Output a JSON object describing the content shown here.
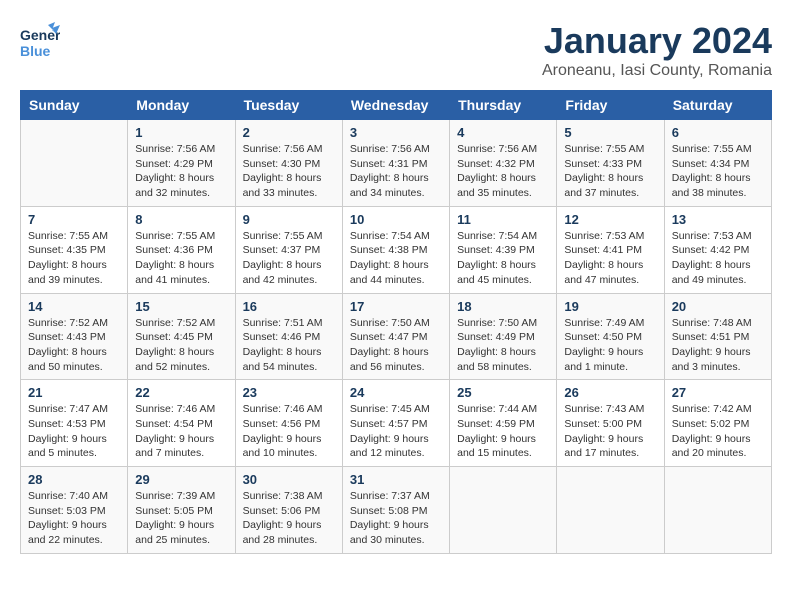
{
  "header": {
    "logo_general": "General",
    "logo_blue": "Blue",
    "month_title": "January 2024",
    "location": "Aroneanu, Iasi County, Romania"
  },
  "weekdays": [
    "Sunday",
    "Monday",
    "Tuesday",
    "Wednesday",
    "Thursday",
    "Friday",
    "Saturday"
  ],
  "weeks": [
    [
      {
        "day": "",
        "sunrise": "",
        "sunset": "",
        "daylight": ""
      },
      {
        "day": "1",
        "sunrise": "Sunrise: 7:56 AM",
        "sunset": "Sunset: 4:29 PM",
        "daylight": "Daylight: 8 hours and 32 minutes."
      },
      {
        "day": "2",
        "sunrise": "Sunrise: 7:56 AM",
        "sunset": "Sunset: 4:30 PM",
        "daylight": "Daylight: 8 hours and 33 minutes."
      },
      {
        "day": "3",
        "sunrise": "Sunrise: 7:56 AM",
        "sunset": "Sunset: 4:31 PM",
        "daylight": "Daylight: 8 hours and 34 minutes."
      },
      {
        "day": "4",
        "sunrise": "Sunrise: 7:56 AM",
        "sunset": "Sunset: 4:32 PM",
        "daylight": "Daylight: 8 hours and 35 minutes."
      },
      {
        "day": "5",
        "sunrise": "Sunrise: 7:55 AM",
        "sunset": "Sunset: 4:33 PM",
        "daylight": "Daylight: 8 hours and 37 minutes."
      },
      {
        "day": "6",
        "sunrise": "Sunrise: 7:55 AM",
        "sunset": "Sunset: 4:34 PM",
        "daylight": "Daylight: 8 hours and 38 minutes."
      }
    ],
    [
      {
        "day": "7",
        "sunrise": "Sunrise: 7:55 AM",
        "sunset": "Sunset: 4:35 PM",
        "daylight": "Daylight: 8 hours and 39 minutes."
      },
      {
        "day": "8",
        "sunrise": "Sunrise: 7:55 AM",
        "sunset": "Sunset: 4:36 PM",
        "daylight": "Daylight: 8 hours and 41 minutes."
      },
      {
        "day": "9",
        "sunrise": "Sunrise: 7:55 AM",
        "sunset": "Sunset: 4:37 PM",
        "daylight": "Daylight: 8 hours and 42 minutes."
      },
      {
        "day": "10",
        "sunrise": "Sunrise: 7:54 AM",
        "sunset": "Sunset: 4:38 PM",
        "daylight": "Daylight: 8 hours and 44 minutes."
      },
      {
        "day": "11",
        "sunrise": "Sunrise: 7:54 AM",
        "sunset": "Sunset: 4:39 PM",
        "daylight": "Daylight: 8 hours and 45 minutes."
      },
      {
        "day": "12",
        "sunrise": "Sunrise: 7:53 AM",
        "sunset": "Sunset: 4:41 PM",
        "daylight": "Daylight: 8 hours and 47 minutes."
      },
      {
        "day": "13",
        "sunrise": "Sunrise: 7:53 AM",
        "sunset": "Sunset: 4:42 PM",
        "daylight": "Daylight: 8 hours and 49 minutes."
      }
    ],
    [
      {
        "day": "14",
        "sunrise": "Sunrise: 7:52 AM",
        "sunset": "Sunset: 4:43 PM",
        "daylight": "Daylight: 8 hours and 50 minutes."
      },
      {
        "day": "15",
        "sunrise": "Sunrise: 7:52 AM",
        "sunset": "Sunset: 4:45 PM",
        "daylight": "Daylight: 8 hours and 52 minutes."
      },
      {
        "day": "16",
        "sunrise": "Sunrise: 7:51 AM",
        "sunset": "Sunset: 4:46 PM",
        "daylight": "Daylight: 8 hours and 54 minutes."
      },
      {
        "day": "17",
        "sunrise": "Sunrise: 7:50 AM",
        "sunset": "Sunset: 4:47 PM",
        "daylight": "Daylight: 8 hours and 56 minutes."
      },
      {
        "day": "18",
        "sunrise": "Sunrise: 7:50 AM",
        "sunset": "Sunset: 4:49 PM",
        "daylight": "Daylight: 8 hours and 58 minutes."
      },
      {
        "day": "19",
        "sunrise": "Sunrise: 7:49 AM",
        "sunset": "Sunset: 4:50 PM",
        "daylight": "Daylight: 9 hours and 1 minute."
      },
      {
        "day": "20",
        "sunrise": "Sunrise: 7:48 AM",
        "sunset": "Sunset: 4:51 PM",
        "daylight": "Daylight: 9 hours and 3 minutes."
      }
    ],
    [
      {
        "day": "21",
        "sunrise": "Sunrise: 7:47 AM",
        "sunset": "Sunset: 4:53 PM",
        "daylight": "Daylight: 9 hours and 5 minutes."
      },
      {
        "day": "22",
        "sunrise": "Sunrise: 7:46 AM",
        "sunset": "Sunset: 4:54 PM",
        "daylight": "Daylight: 9 hours and 7 minutes."
      },
      {
        "day": "23",
        "sunrise": "Sunrise: 7:46 AM",
        "sunset": "Sunset: 4:56 PM",
        "daylight": "Daylight: 9 hours and 10 minutes."
      },
      {
        "day": "24",
        "sunrise": "Sunrise: 7:45 AM",
        "sunset": "Sunset: 4:57 PM",
        "daylight": "Daylight: 9 hours and 12 minutes."
      },
      {
        "day": "25",
        "sunrise": "Sunrise: 7:44 AM",
        "sunset": "Sunset: 4:59 PM",
        "daylight": "Daylight: 9 hours and 15 minutes."
      },
      {
        "day": "26",
        "sunrise": "Sunrise: 7:43 AM",
        "sunset": "Sunset: 5:00 PM",
        "daylight": "Daylight: 9 hours and 17 minutes."
      },
      {
        "day": "27",
        "sunrise": "Sunrise: 7:42 AM",
        "sunset": "Sunset: 5:02 PM",
        "daylight": "Daylight: 9 hours and 20 minutes."
      }
    ],
    [
      {
        "day": "28",
        "sunrise": "Sunrise: 7:40 AM",
        "sunset": "Sunset: 5:03 PM",
        "daylight": "Daylight: 9 hours and 22 minutes."
      },
      {
        "day": "29",
        "sunrise": "Sunrise: 7:39 AM",
        "sunset": "Sunset: 5:05 PM",
        "daylight": "Daylight: 9 hours and 25 minutes."
      },
      {
        "day": "30",
        "sunrise": "Sunrise: 7:38 AM",
        "sunset": "Sunset: 5:06 PM",
        "daylight": "Daylight: 9 hours and 28 minutes."
      },
      {
        "day": "31",
        "sunrise": "Sunrise: 7:37 AM",
        "sunset": "Sunset: 5:08 PM",
        "daylight": "Daylight: 9 hours and 30 minutes."
      },
      {
        "day": "",
        "sunrise": "",
        "sunset": "",
        "daylight": ""
      },
      {
        "day": "",
        "sunrise": "",
        "sunset": "",
        "daylight": ""
      },
      {
        "day": "",
        "sunrise": "",
        "sunset": "",
        "daylight": ""
      }
    ]
  ]
}
